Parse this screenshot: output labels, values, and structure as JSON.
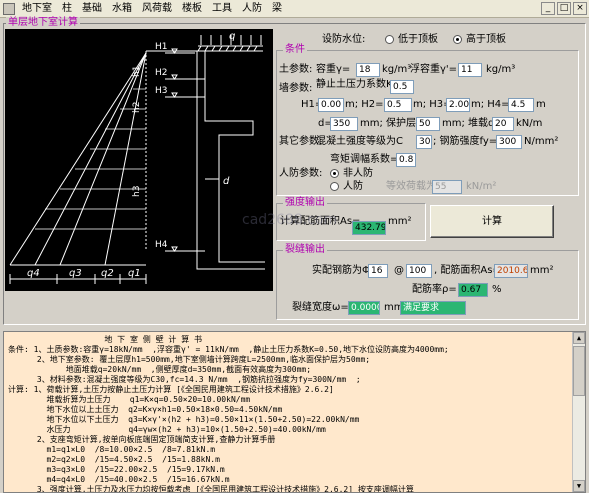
{
  "menu": {
    "items": [
      "地下室",
      "柱",
      "基础",
      "水箱",
      "风荷载",
      "楼板",
      "工具",
      "人防",
      "梁"
    ],
    "controls": [
      "_",
      "□",
      "×"
    ]
  },
  "panel_title": "单层地下室计算",
  "diagram": {
    "labels": {
      "q": "q",
      "h1": "h1",
      "h2": "h2",
      "h3": "h3",
      "H1": "H1",
      "H2": "H2",
      "H3": "H3",
      "H4": "H4",
      "d": "d",
      "q4": "q4",
      "q3": "q3",
      "q2": "q2",
      "q1": "q1"
    }
  },
  "water_level": {
    "label": "设防水位:",
    "options": [
      "低于顶板",
      "高于顶板"
    ],
    "selected": 1
  },
  "conditions": {
    "title": "条件",
    "soil_label": "土参数:",
    "unit_weight_label": "容重γ=",
    "unit_weight": "18",
    "unit_weight_unit": "kg/m³",
    "buoyant_label": "浮容重γ'=",
    "buoyant": "11",
    "buoyant_unit": "kg/m³",
    "wall_label": "墙参数:",
    "earth_coef_label": "静止土压力系数K=",
    "earth_coef": "0.5",
    "h1_label": "H1=",
    "h1": "0.00",
    "h2_label": "m; H2=",
    "h2": "0.5",
    "h3_label": "m; H3=",
    "h3": "2.00",
    "h4_label": "m; H4=",
    "h4": "4.5",
    "h4_unit": "m",
    "d_label": "d=",
    "d": "350",
    "cover_label": "mm; 保护层厚",
    "cover": "50",
    "load_label": "mm; 堆载q=",
    "load": "20",
    "load_unit": "kN/m",
    "other_label": "其它参数:",
    "concrete_label": "混凝土强度等级为C",
    "concrete": "30",
    "steel_label": "; 钢筋强度fy=",
    "steel": "300",
    "steel_unit": "N/mm²",
    "moment_label": "弯矩调幅系数=",
    "moment": "0.8",
    "civil_label": "人防参数:",
    "civil_options": [
      "非人防",
      "人防"
    ],
    "civil_selected": 0,
    "equiv_label": "等效荷载为",
    "equiv": "55",
    "equiv_unit": "kN/m²"
  },
  "strength": {
    "title": "强度输出",
    "area_label": "计算配筋面积As=",
    "area": "432.79",
    "area_unit": "mm²",
    "calc_button": "计算"
  },
  "crack": {
    "title": "裂缝输出",
    "bar_label": "实配钢筋为Φ",
    "bar_dia": "16",
    "at_label": "@",
    "spacing": "100",
    "area_label": ", 配筋面积As=",
    "area": "2010.6",
    "area_unit": "mm²",
    "ratio_label": "配筋率ρ=",
    "ratio": "0.67",
    "ratio_unit": "%",
    "width_label": "裂缝宽度ω=",
    "width": "0.0000",
    "width_unit": "mm",
    "status": "满足要求"
  },
  "report": {
    "lines": [
      "                    地 下 室 侧 壁 计 算 书",
      "条件: 1、土质参数:容重γ=18kN/mm  ,浮容重γ' = 11kN/mm  ,静止土压力系数K=0.50,地下水位设防高度为4000mm;",
      "      2、地下室参数: 覆土层厚h1=500mm,地下室侧墙计算跨度L=2500mm,临水面保护层为50mm;",
      "            地面堆载q=20kN/mm  ,侧壁厚度d=350mm,截面有效高度为300mm;",
      "      3、材料参数:混凝土强度等级为C30,fc=14.3 N/mm  ,钢筋抗拉强度为fy=300N/mm  ;",
      "计算: 1、荷载计算,土压力按静止土压力计算 [《全国民用建筑工程设计技术措施》2.6.2]",
      "        堆载折算为土压力    q1=K×q=0.50×20=10.00kN/mm",
      "        地下水位以上土压力  q2=K×γ×h1=0.50×18×0.50=4.50kN/mm",
      "        地下水位以下土压力  q3=K×γ'×(h2 + h3)=0.50×11×(1.50+2.50)=22.00kN/mm",
      "        水压力            q4=γw×(h2 + h3)=10×(1.50+2.50)=40.00kN/mm",
      "      2、支座弯矩计算,按单向板底端固定顶端简支计算,查静力计算手册",
      "        m1=q1×L0  /8=10.00×2.5  /8=7.81kN.m",
      "        m2=q2×L0  /15=4.50×2.5  /15=1.88kN.m",
      "        m3=q3×L0  /15=22.00×2.5  /15=9.17kN.m",
      "        m4=q4×L0  /15=40.00×2.5  /15=16.67kN.m",
      "      3、强度计算,土压力及水压力均按恒载考虑 [《全国民用建筑工程设计技术措施》2.6.2] 按支座调幅计算"
    ]
  },
  "watermark": "cad2688.com"
}
